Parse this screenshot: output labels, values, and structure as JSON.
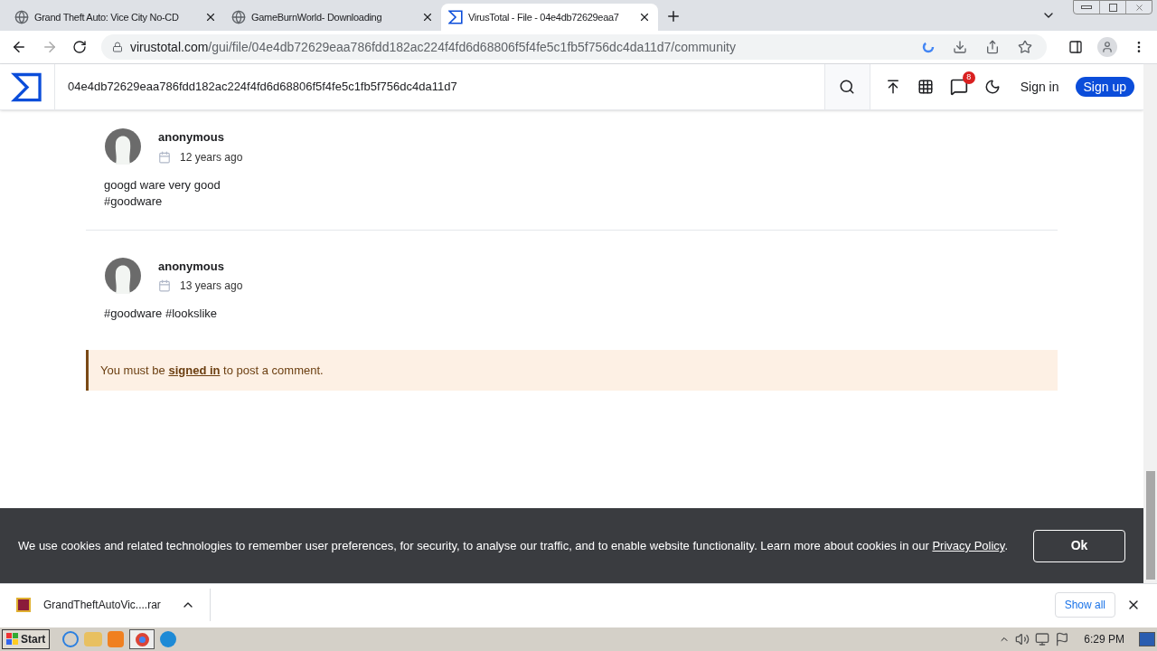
{
  "browser": {
    "tabs": [
      {
        "title": "Grand Theft Auto: Vice City No-CD",
        "kind": "globe",
        "selected": false
      },
      {
        "title": "GameBurnWorld- Downloading",
        "kind": "globe",
        "selected": false
      },
      {
        "title": "VirusTotal - File - 04e4db72629eaa7",
        "kind": "sigma",
        "selected": true
      }
    ],
    "url_host": "virustotal.com",
    "url_path": "/gui/file/04e4db72629eaa786fdd182ac224f4fd6d68806f5f4fe5c1fb5f756dc4da11d7/community"
  },
  "header": {
    "search_value": "04e4db72629eaa786fdd182ac224f4fd6d68806f5f4fe5c1fb5f756dc4da11d7",
    "notification_count": "8",
    "sign_in": "Sign in",
    "sign_up": "Sign up"
  },
  "comments": [
    {
      "author": "anonymous",
      "time": "12 years ago",
      "lines": [
        "googd ware very good",
        "#goodware"
      ]
    },
    {
      "author": "anonymous",
      "time": "13 years ago",
      "lines": [
        "#goodware #lookslike"
      ]
    }
  ],
  "notice": {
    "before": "You must be",
    "link": "signed in",
    "after": "to post a comment."
  },
  "cookie_banner": {
    "text": "We use cookies and related technologies to remember user preferences, for security, to analyse our traffic, and to enable website functionality. Learn more about cookies in our",
    "link": "Privacy Policy",
    "after": ".",
    "button": "Ok"
  },
  "download_bar": {
    "file": "GrandTheftAutoVic....rar",
    "show_all": "Show all"
  },
  "taskbar": {
    "start": "Start",
    "time": "6:29 PM"
  }
}
